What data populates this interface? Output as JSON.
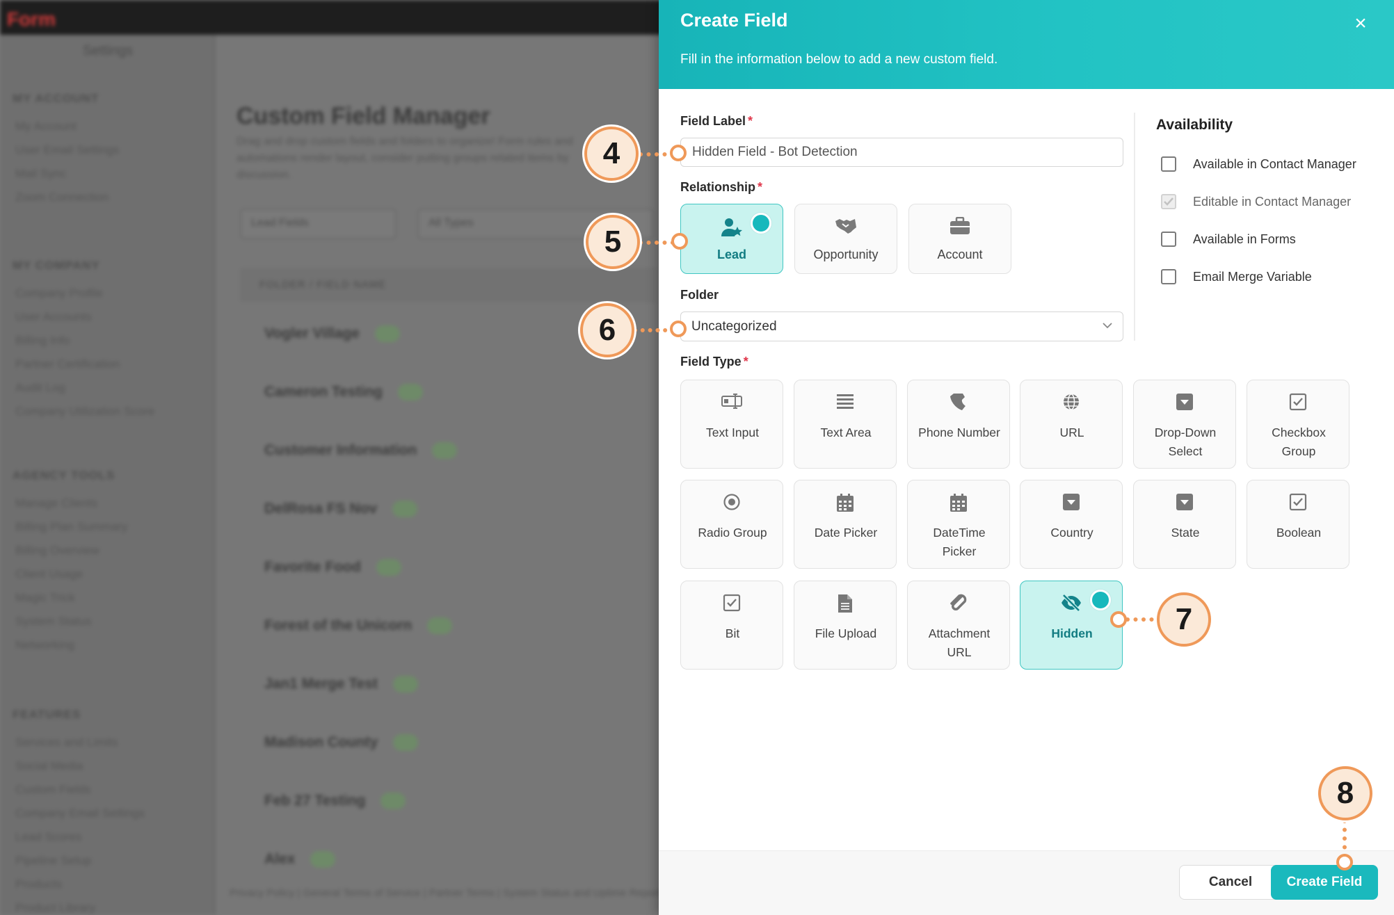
{
  "background": {
    "logo": "Form",
    "sidebar_title": "Settings",
    "sections": [
      {
        "title": "MY ACCOUNT",
        "links": [
          "My Account",
          "User Email Settings",
          "Mail Sync",
          "Zoom Connection"
        ]
      },
      {
        "title": "MY COMPANY",
        "links": [
          "Company Profile",
          "User Accounts",
          "Billing Info",
          "Partner Certification",
          "Audit Log",
          "Company Utilization Score"
        ]
      },
      {
        "title": "AGENCY TOOLS",
        "links": [
          "Manage Clients",
          "Billing Plan Summary",
          "Billing Overview",
          "Client Usage",
          "Magic Trick",
          "System Status",
          "Networking"
        ]
      },
      {
        "title": "FEATURES",
        "links": [
          "Services and Limits",
          "Social Media",
          "Custom Fields",
          "Company Email Settings",
          "Lead Scores",
          "Pipeline Setup",
          "Products",
          "Product Library"
        ]
      }
    ],
    "page_title": "Custom Field Manager",
    "page_desc": "Drag and drop custom fields and folders to organize! Form rules and automations\nrender layout, consider putting groups related items by discussion.",
    "filter_1": "Lead Fields",
    "filter_2": "All Types",
    "table_header": "FOLDER / FIELD NAME",
    "rows": [
      "Vogler Village",
      "Cameron Testing",
      "Customer Information",
      "DelRosa FS Nov",
      "Favorite Food",
      "Forest of the Unicorn",
      "Jan1 Merge Test",
      "Madison County",
      "Feb 27 Testing",
      "Alex"
    ],
    "footer": "Privacy Policy | General Terms of Service | Partner Terms | System Status and Uptime Report"
  },
  "modal": {
    "title": "Create Field",
    "subtitle": "Fill in the information below to add a new custom field.",
    "close_icon": "×",
    "field_label": {
      "label": "Field Label",
      "value": "Hidden Field - Bot Detection"
    },
    "relationship": {
      "label": "Relationship",
      "options": [
        {
          "label": "Lead",
          "icon": "user-star-icon",
          "selected": true
        },
        {
          "label": "Opportunity",
          "icon": "handshake-icon",
          "selected": false
        },
        {
          "label": "Account",
          "icon": "briefcase-icon",
          "selected": false
        }
      ]
    },
    "folder": {
      "label": "Folder",
      "value": "Uncategorized"
    },
    "field_type": {
      "label": "Field Type",
      "options": [
        {
          "label": "Text Input",
          "icon": "text-cursor-icon"
        },
        {
          "label": "Text Area",
          "icon": "lines-icon"
        },
        {
          "label": "Phone Number",
          "icon": "phone-icon"
        },
        {
          "label": "URL",
          "icon": "globe-icon"
        },
        {
          "label": "Drop-Down Select",
          "icon": "dropdown-icon"
        },
        {
          "label": "Checkbox Group",
          "icon": "checkbox-icon"
        },
        {
          "label": "Radio Group",
          "icon": "radio-icon"
        },
        {
          "label": "Date Picker",
          "icon": "calendar-icon"
        },
        {
          "label": "DateTime Picker",
          "icon": "calendar-icon"
        },
        {
          "label": "Country",
          "icon": "dropdown-icon"
        },
        {
          "label": "State",
          "icon": "dropdown-icon"
        },
        {
          "label": "Boolean",
          "icon": "checkbox-icon"
        },
        {
          "label": "Bit",
          "icon": "checkbox-icon"
        },
        {
          "label": "File Upload",
          "icon": "file-icon"
        },
        {
          "label": "Attachment URL",
          "icon": "paperclip-icon"
        },
        {
          "label": "Hidden",
          "icon": "eye-slash-icon",
          "selected": true
        }
      ]
    },
    "availability": {
      "title": "Availability",
      "items": [
        {
          "label": "Available in Contact Manager",
          "checked": false,
          "disabled": false
        },
        {
          "label": "Editable in Contact Manager",
          "checked": true,
          "disabled": true
        },
        {
          "label": "Available in Forms",
          "checked": false,
          "disabled": false
        },
        {
          "label": "Email Merge Variable",
          "checked": false,
          "disabled": false
        }
      ]
    },
    "buttons": {
      "cancel": "Cancel",
      "create": "Create Field"
    }
  },
  "callouts": [
    "4",
    "5",
    "6",
    "7",
    "8"
  ],
  "colors": {
    "accent": "#1ab9bd",
    "selected_bg": "#c9f3ef",
    "callout": "#ef9959",
    "required": "#e0364a"
  }
}
